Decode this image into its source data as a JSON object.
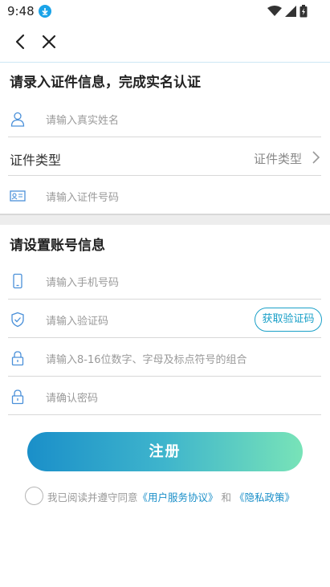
{
  "status_bar": {
    "time": "9:48"
  },
  "section_identity": {
    "title": "请录入证件信息，完成实名认证",
    "name_placeholder": "请输入真实姓名",
    "id_type_label": "证件类型",
    "id_type_value": "证件类型",
    "id_number_placeholder": "请输入证件号码"
  },
  "section_account": {
    "title": "请设置账号信息",
    "phone_placeholder": "请输入手机号码",
    "code_placeholder": "请输入验证码",
    "get_code_label": "获取验证码",
    "password_placeholder": "请输入8-16位数字、字母及标点符号的组合",
    "confirm_placeholder": "请确认密码"
  },
  "register_label": "注册",
  "agreement": {
    "prefix": "我已阅读并遵守同意",
    "user_agreement": "《用户服务协议》",
    "and": "和",
    "privacy_policy": "《隐私政策》"
  },
  "colors": {
    "accent": "#1aa0c8",
    "gradient_start": "#1a8fc9",
    "gradient_end": "#78e3b8"
  },
  "icons": [
    "download-icon",
    "wifi-icon",
    "signal-icon",
    "battery-icon",
    "back-icon",
    "close-icon",
    "user-icon",
    "id-card-icon",
    "phone-icon",
    "shield-icon",
    "lock-icon",
    "chevron-right-icon"
  ]
}
